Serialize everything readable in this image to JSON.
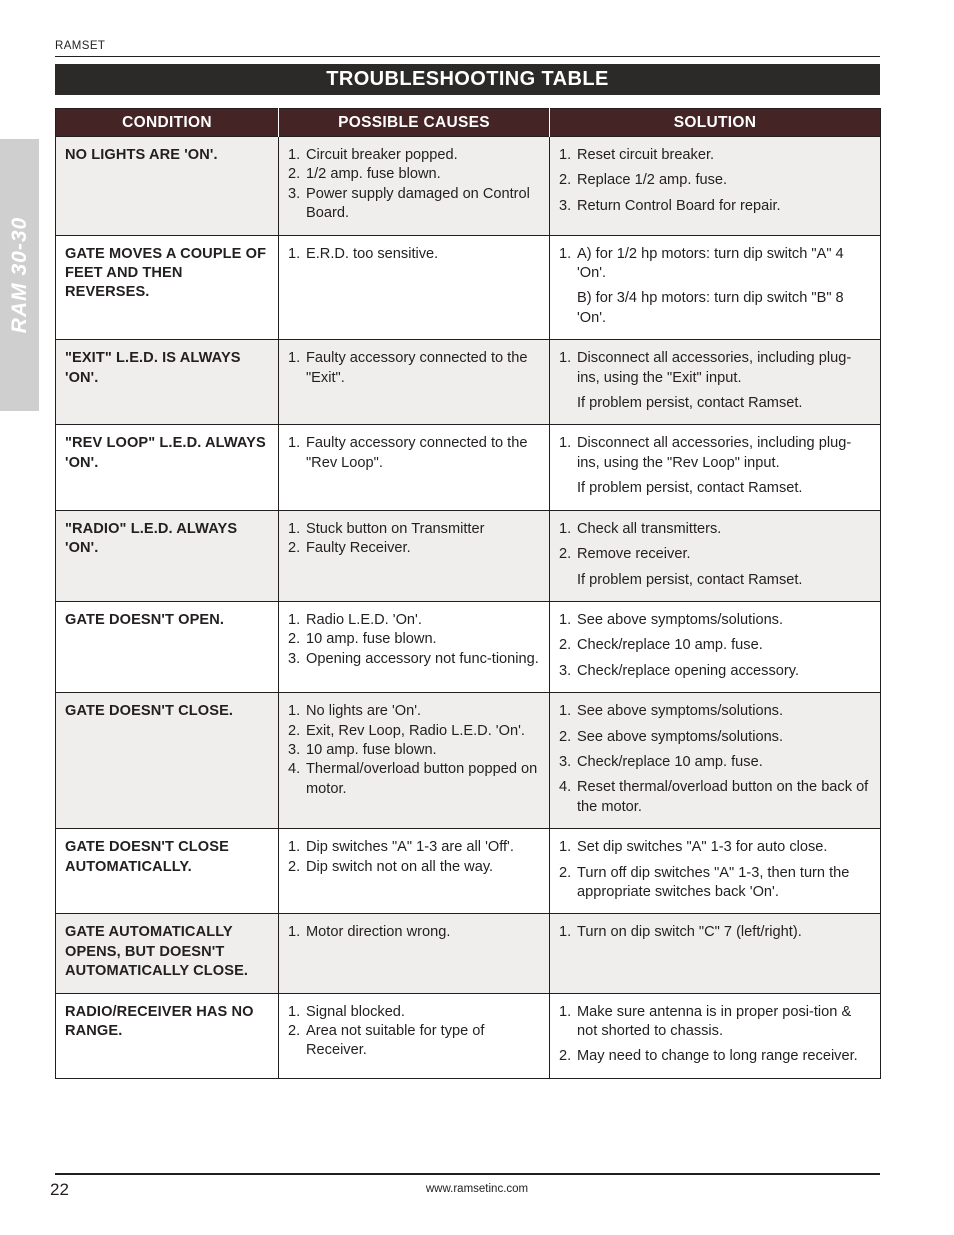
{
  "running_head": "RAMSET",
  "side_tab": {
    "label": "RAM 30-30"
  },
  "banner": {
    "title": "TROUBLESHOOTING TABLE"
  },
  "colors": {
    "banner_bg": "#2b2a28",
    "header_bg": "#452425",
    "condition_text": "#5a2b2d",
    "stripe_bg": "#efeeec",
    "side_tab_bg": "#cfcfcf"
  },
  "table": {
    "headers": [
      "CONDITION",
      "POSSIBLE CAUSES",
      "SOLUTION"
    ],
    "rows": [
      {
        "condition": "NO LIGHTS ARE 'ON'.",
        "causes": [
          {
            "num": "1.",
            "text": "Circuit breaker popped."
          },
          {
            "num": "2.",
            "text": "1/2 amp. fuse blown."
          },
          {
            "num": "3.",
            "text": "Power supply damaged on Control Board."
          }
        ],
        "solutions": [
          {
            "num": "1.",
            "text": "Reset circuit breaker."
          },
          {
            "num": "2.",
            "text": "Replace 1/2 amp. fuse."
          },
          {
            "num": "3.",
            "text": "Return Control Board for repair."
          }
        ]
      },
      {
        "condition": "GATE MOVES A COUPLE OF FEET AND THEN REVERSES.",
        "causes": [
          {
            "num": "1.",
            "text": "E.R.D. too sensitive."
          }
        ],
        "solutions": [
          {
            "num": "1.",
            "text": "A) for 1/2 hp motors: turn dip switch \"A\" 4 'On'."
          },
          {
            "num": "",
            "text": "B) for 3/4 hp motors: turn dip switch \"B\" 8 'On'."
          }
        ]
      },
      {
        "condition": "\"EXIT\" L.E.D. IS ALWAYS 'ON'.",
        "causes": [
          {
            "num": "1.",
            "text": "Faulty accessory connected to the \"Exit\"."
          }
        ],
        "solutions": [
          {
            "num": "1.",
            "text": "Disconnect all accessories, including plug-ins, using the \"Exit\" input."
          },
          {
            "num": "",
            "text": "If problem persist, contact Ramset."
          }
        ]
      },
      {
        "condition": "\"REV LOOP\" L.E.D. ALWAYS 'ON'.",
        "causes": [
          {
            "num": "1.",
            "text": "Faulty accessory connected to the \"Rev Loop\"."
          }
        ],
        "solutions": [
          {
            "num": "1.",
            "text": "Disconnect all accessories, including plug-ins, using the \"Rev Loop\" input."
          },
          {
            "num": "",
            "text": "If problem persist, contact Ramset."
          }
        ]
      },
      {
        "condition": "\"RADIO\" L.E.D. ALWAYS 'ON'.",
        "causes": [
          {
            "num": "1.",
            "text": "Stuck button on Transmitter"
          },
          {
            "num": "2.",
            "text": "Faulty Receiver."
          }
        ],
        "solutions": [
          {
            "num": "1.",
            "text": "Check all transmitters."
          },
          {
            "num": "2.",
            "text": "Remove receiver."
          },
          {
            "num": "",
            "text": "If problem persist, contact Ramset."
          }
        ]
      },
      {
        "condition": "GATE DOESN'T OPEN.",
        "causes": [
          {
            "num": "1.",
            "text": "Radio L.E.D. 'On'."
          },
          {
            "num": "2.",
            "text": "10 amp. fuse blown."
          },
          {
            "num": "3.",
            "text": "Opening accessory not func-tioning."
          }
        ],
        "solutions": [
          {
            "num": "1.",
            "text": "See above symptoms/solutions."
          },
          {
            "num": "2.",
            "text": "Check/replace 10 amp. fuse."
          },
          {
            "num": "3.",
            "text": "Check/replace opening accessory."
          }
        ]
      },
      {
        "condition": "GATE DOESN'T CLOSE.",
        "causes": [
          {
            "num": "1.",
            "text": "No lights are 'On'."
          },
          {
            "num": "2.",
            "text": "Exit, Rev Loop, Radio L.E.D. 'On'."
          },
          {
            "num": "3.",
            "text": "10 amp. fuse blown."
          },
          {
            "num": "4.",
            "text": "Thermal/overload button popped on motor."
          }
        ],
        "solutions": [
          {
            "num": "1.",
            "text": "See above symptoms/solutions."
          },
          {
            "num": "2.",
            "text": "See above symptoms/solutions."
          },
          {
            "num": "3.",
            "text": "Check/replace 10 amp. fuse."
          },
          {
            "num": "4.",
            "text": "Reset thermal/overload button on the back of the motor."
          }
        ]
      },
      {
        "condition": "GATE DOESN'T CLOSE AUTOMATICALLY.",
        "causes": [
          {
            "num": "1.",
            "text": "Dip switches \"A\" 1-3 are all 'Off'."
          },
          {
            "num": "2.",
            "text": "Dip switch not on all the way."
          }
        ],
        "solutions": [
          {
            "num": "1.",
            "text": "Set dip switches \"A\" 1-3 for auto close."
          },
          {
            "num": "2.",
            "text": "Turn off dip switches \"A\" 1-3, then turn the appropriate switches back 'On'."
          }
        ]
      },
      {
        "condition": "GATE AUTOMATICALLY OPENS, BUT DOESN'T AUTOMATICALLY CLOSE.",
        "causes": [
          {
            "num": "1.",
            "text": "Motor direction wrong."
          }
        ],
        "solutions": [
          {
            "num": "1.",
            "text": "Turn on dip switch \"C\" 7 (left/right)."
          }
        ]
      },
      {
        "condition": "RADIO/RECEIVER HAS NO RANGE.",
        "causes": [
          {
            "num": "1.",
            "text": "Signal blocked."
          },
          {
            "num": "2.",
            "text": "Area not suitable for type of Receiver."
          }
        ],
        "solutions": [
          {
            "num": "1.",
            "text": "Make sure antenna is in proper posi-tion & not shorted to chassis."
          },
          {
            "num": "2.",
            "text": "May need to change to long range receiver."
          }
        ]
      }
    ]
  },
  "footer": {
    "page_number": "22",
    "url": "www.ramsetinc.com"
  }
}
